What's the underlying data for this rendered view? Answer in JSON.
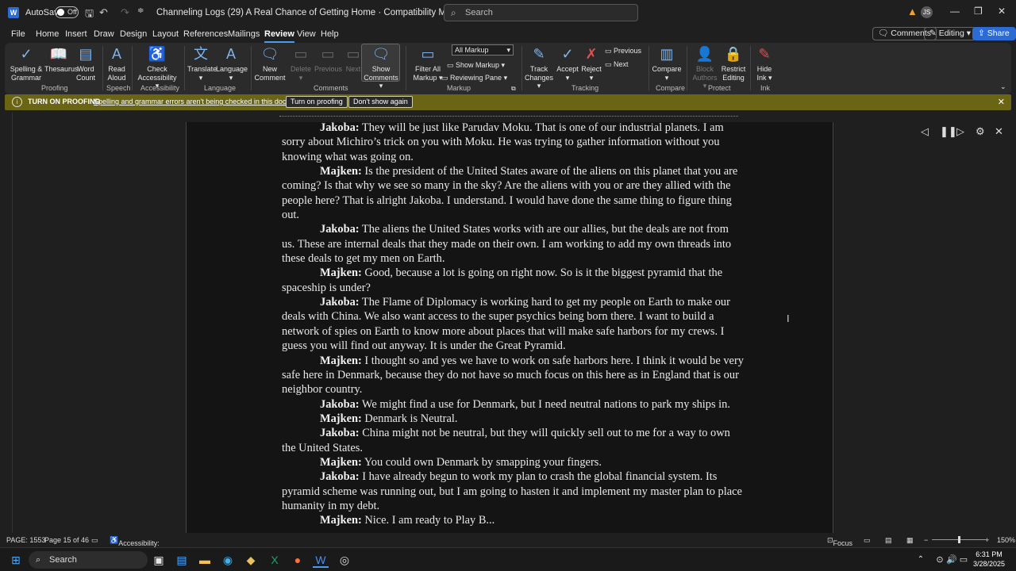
{
  "titlebar": {
    "app_icon": "W",
    "autosave_label": "AutoSave",
    "autosave_state": "Off",
    "doc_title": "Channeling Logs (29) A Real Chance of Getting Home  ·  Compatibility Mode  ·  Saved",
    "search_placeholder": "Search",
    "user_initials": "JS"
  },
  "menu": [
    "File",
    "Home",
    "Insert",
    "Draw",
    "Design",
    "Layout",
    "References",
    "Mailings",
    "Review",
    "View",
    "Help"
  ],
  "menu_active": "Review",
  "top_right": {
    "comments": "Comments",
    "editing": "Editing",
    "share": "Share"
  },
  "ribbon": {
    "spelling": "Spelling &\nGrammar",
    "thesaurus": "Thesaurus",
    "word_count": "Word\nCount",
    "read_aloud": "Read\nAloud",
    "check_accessibility": "Check\nAccessibility",
    "translate": "Translate",
    "language": "Language",
    "new_comment": "New\nComment",
    "delete": "Delete",
    "previous": "Previous",
    "next": "Next",
    "show_comments": "Show\nComments",
    "filter_all_markup": "Filter All\nMarkup",
    "markup_select": "All Markup",
    "show_markup": "Show Markup",
    "reviewing_pane": "Reviewing Pane",
    "track_changes": "Track\nChanges",
    "accept": "Accept",
    "reject": "Reject",
    "prev_change": "Previous",
    "next_change": "Next",
    "compare": "Compare",
    "block_authors": "Block\nAuthors",
    "restrict_editing": "Restrict\nEditing",
    "hide_ink": "Hide\nInk",
    "groups": {
      "proofing": "Proofing",
      "speech": "Speech",
      "accessibility": "Accessibility",
      "language": "Language",
      "comments": "Comments",
      "markup": "Markup",
      "tracking": "Tracking",
      "compare": "Compare",
      "protect": "Protect",
      "ink": "Ink"
    }
  },
  "infobar": {
    "title": "TURN ON PROOFING",
    "message": "Spelling and grammar errors aren't being checked in this document.",
    "turn_on": "Turn on proofing",
    "dont_show": "Don't show again"
  },
  "document": {
    "paragraphs": [
      {
        "speaker": "Jakoba:",
        "text": " They will be just like Parudav Moku.  That is one of our industrial planets.  I am sorry about Michiro’s trick on you with Moku.  He was trying to gather information without you knowing what was going on."
      },
      {
        "speaker": "Majken:",
        "text": " Is the president of the United States aware of the aliens on this planet that you are coming?  Is that why we see so many in the sky?  Are the aliens with you or are they allied with the people here?  That is alright Jakoba.  I understand.  I would have done the same thing to figure thing out."
      },
      {
        "speaker": "Jakoba:",
        "text": " The aliens the United States works with are our allies, but the deals are not from us.  These are internal deals that they made on their own.  I am working to add my own threads into these deals to get my men on Earth."
      },
      {
        "speaker": "Majken:",
        "text": " Good, because a lot is going on right now.  So is it the biggest pyramid that the spaceship is under?"
      },
      {
        "speaker": "Jakoba:",
        "text": " The Flame of Diplomacy is working hard to get my people on Earth to make our deals with China.  We also want access to the super psychics being born there.  I want to build a network of spies on Earth to know more about places that will make safe harbors for my crews.  I guess you will find out anyway.  It is under the Great Pyramid."
      },
      {
        "speaker": "Majken:",
        "text": " I thought so and yes we have to work on safe harbors here.  I think it would be very safe here in Denmark, because they do not have so much focus on this here as in England that is our neighbor country."
      },
      {
        "speaker": "Jakoba:",
        "text": " We might find a use for Denmark, but I need neutral nations to park my ships in."
      },
      {
        "speaker": "Majken:",
        "text": " Denmark is Neutral."
      },
      {
        "speaker": "Jakoba:",
        "text": " China might not be neutral, but they will quickly sell out to me for a way to own the United States."
      },
      {
        "speaker": "Majken:",
        "text": " You could own Denmark by smapping your fingers."
      },
      {
        "speaker": "Jakoba:",
        "text": " I have already begun to work my plan to crash the global financial system.  Its pyramid scheme was running out, but I am going to hasten it and implement my master plan to place humanity in my debt."
      },
      {
        "speaker": "Majken:",
        "text": " Nice. I am ready to Play B..."
      }
    ]
  },
  "statusbar": {
    "page": "PAGE: 1553",
    "page_of": "Page 15 of 46",
    "accessibility": "Accessibility: Unavailable",
    "focus": "Focus",
    "zoom": "150%"
  },
  "taskbar": {
    "search": "Search",
    "time": "6:31 PM",
    "date": "3/28/2025"
  }
}
